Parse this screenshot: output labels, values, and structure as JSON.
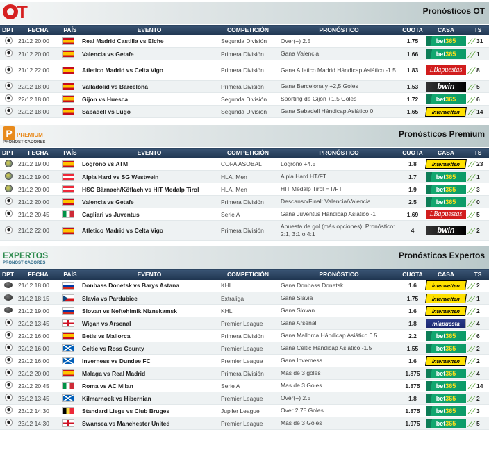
{
  "columns": [
    "DPT",
    "FECHA",
    "PAÍS",
    "EVENTO",
    "COMPETICIÓN",
    "PRONÓSTICO",
    "CUOTA",
    "CASA",
    "TS"
  ],
  "sections": [
    {
      "title": "Pronósticos OT",
      "logo": {
        "name": "ot-logo",
        "text_o": "O",
        "text_t": "T"
      },
      "rows": [
        {
          "sport": "football",
          "fecha": "21/12 20:00",
          "pais": "spain",
          "evento": "Real Madrid Castilla vs Elche",
          "competicion": "Segunda División",
          "pronostico": "Over(+) 2.5",
          "cuota": "1.75",
          "casa": "bet365",
          "ts": "31"
        },
        {
          "sport": "football",
          "fecha": "21/12 20:00",
          "pais": "spain",
          "evento": "Valencia vs Getafe",
          "competicion": "Primera División",
          "pronostico": "Gana Valencia",
          "cuota": "1.66",
          "casa": "bet365",
          "ts": "1"
        },
        {
          "sport": "football",
          "fecha": "21/12 22:00",
          "pais": "spain",
          "evento": "Atletico Madrid vs Celta Vigo",
          "competicion": "Primera División",
          "pronostico": "Gana Atletico Madrid Hándicap Asiático -1.5",
          "cuota": "1.83",
          "casa": "lbapuestas",
          "ts": "8",
          "tall": true
        },
        {
          "sport": "football",
          "fecha": "22/12 18:00",
          "pais": "spain",
          "evento": "Valladolid vs Barcelona",
          "competicion": "Primera División",
          "pronostico": "Gana Barcelona y +2,5 Goles",
          "cuota": "1.53",
          "casa": "bwin",
          "ts": "5"
        },
        {
          "sport": "football",
          "fecha": "22/12 18:00",
          "pais": "spain",
          "evento": "Gijon vs Huesca",
          "competicion": "Segunda División",
          "pronostico": "Sporting de Gijón +1,5 Goles",
          "cuota": "1.72",
          "casa": "bet365",
          "ts": "6"
        },
        {
          "sport": "football",
          "fecha": "22/12 18:00",
          "pais": "spain",
          "evento": "Sabadell vs Lugo",
          "competicion": "Segunda División",
          "pronostico": "Gana Sabadell Hándicap Asiático 0",
          "cuota": "1.65",
          "casa": "interwetten",
          "ts": "14"
        }
      ]
    },
    {
      "title": "Pronósticos Premium",
      "logo": {
        "name": "premium-logo",
        "letter": "P",
        "word": "PREMIUM",
        "sub": "PRONOSTICADORES"
      },
      "rows": [
        {
          "sport": "handball",
          "fecha": "21/12 19:00",
          "pais": "spain",
          "evento": "Logroño vs ATM",
          "competicion": "COPA ASOBAL",
          "pronostico": "Logroño +4.5",
          "cuota": "1.8",
          "casa": "interwetten",
          "ts": "23"
        },
        {
          "sport": "handball",
          "fecha": "21/12 19:00",
          "pais": "austria",
          "evento": "Alpla Hard vs SG Westwein",
          "competicion": "HLA, Men",
          "pronostico": "Alpla Hard HT/FT",
          "cuota": "1.7",
          "casa": "bet365",
          "ts": "1"
        },
        {
          "sport": "handball",
          "fecha": "21/12 20:00",
          "pais": "austria",
          "evento": "HSG Bärnach/Köflach vs HIT Medalp Tirol",
          "competicion": "HLA, Men",
          "pronostico": "HIT Medalp Tirol HT/FT",
          "cuota": "1.9",
          "casa": "bet365",
          "ts": "3"
        },
        {
          "sport": "football",
          "fecha": "21/12 20:00",
          "pais": "spain",
          "evento": "Valencia vs Getafe",
          "competicion": "Primera División",
          "pronostico": "Descanso/Final: Valencia/Valencia",
          "cuota": "2.5",
          "casa": "bet365",
          "ts": "0"
        },
        {
          "sport": "football",
          "fecha": "21/12 20:45",
          "pais": "italy",
          "evento": "Cagliari vs Juventus",
          "competicion": "Serie A",
          "pronostico": "Gana Juventus Hándicap Asiático -1",
          "cuota": "1.69",
          "casa": "lbapuestas",
          "ts": "5"
        },
        {
          "sport": "football",
          "fecha": "21/12 22:00",
          "pais": "spain",
          "evento": "Atletico Madrid vs Celta Vigo",
          "competicion": "Primera División",
          "pronostico": "Apuesta de gol (más opciones): Pronóstico: 2:1, 3:1 o 4:1",
          "cuota": "4",
          "casa": "bwin",
          "ts": "2",
          "tall": true
        }
      ]
    },
    {
      "title": "Pronósticos Expertos",
      "logo": {
        "name": "expertos-logo",
        "word": "EXPERTOS",
        "sub": "PRONOSTICADORES"
      },
      "rows": [
        {
          "sport": "hockey",
          "fecha": "21/12 18:00",
          "pais": "russia",
          "evento": "Donbass Donetsk vs Barys Astana",
          "competicion": "KHL",
          "pronostico": "Gana Donbass Donetsk",
          "cuota": "1.6",
          "casa": "interwetten",
          "ts": "2"
        },
        {
          "sport": "hockey",
          "fecha": "21/12 18:15",
          "pais": "czech",
          "evento": "Slavia vs Pardubice",
          "competicion": "Extraliga",
          "pronostico": "Gana Slavia",
          "cuota": "1.75",
          "casa": "interwetten",
          "ts": "1"
        },
        {
          "sport": "hockey",
          "fecha": "21/12 19:00",
          "pais": "russia",
          "evento": "Slovan vs Neftehimik Niznekamsk",
          "competicion": "KHL",
          "pronostico": "Gana Slovan",
          "cuota": "1.6",
          "casa": "interwetten",
          "ts": "2"
        },
        {
          "sport": "football",
          "fecha": "22/12 13:45",
          "pais": "england",
          "evento": "Wigan vs Arsenal",
          "competicion": "Premier League",
          "pronostico": "Gana Arsenal",
          "cuota": "1.8",
          "casa": "miapuesta",
          "ts": "4"
        },
        {
          "sport": "football",
          "fecha": "22/12 16:00",
          "pais": "spain",
          "evento": "Betis vs Mallorca",
          "competicion": "Primera División",
          "pronostico": "Gana Mallorca Hándicap Asiático 0.5",
          "cuota": "2.2",
          "casa": "bet365",
          "ts": "6"
        },
        {
          "sport": "football",
          "fecha": "22/12 16:00",
          "pais": "scotland",
          "evento": "Celtic vs Ross County",
          "competicion": "Premier League",
          "pronostico": "Gana Celtic Hándicap Asiático -1.5",
          "cuota": "1.55",
          "casa": "bet365",
          "ts": "2"
        },
        {
          "sport": "football",
          "fecha": "22/12 16:00",
          "pais": "scotland",
          "evento": "Inverness vs Dundee FC",
          "competicion": "Premier League",
          "pronostico": "Gana Inverness",
          "cuota": "1.6",
          "casa": "interwetten",
          "ts": "2"
        },
        {
          "sport": "football",
          "fecha": "22/12 20:00",
          "pais": "spain",
          "evento": "Malaga vs Real Madrid",
          "competicion": "Primera División",
          "pronostico": "Mas de 3 goles",
          "cuota": "1.875",
          "casa": "bet365",
          "ts": "4"
        },
        {
          "sport": "football",
          "fecha": "22/12 20:45",
          "pais": "italy",
          "evento": "Roma vs AC Milan",
          "competicion": "Serie A",
          "pronostico": "Mas de 3 Goles",
          "cuota": "1.875",
          "casa": "bet365",
          "ts": "14"
        },
        {
          "sport": "football",
          "fecha": "23/12 13:45",
          "pais": "scotland",
          "evento": "Kilmarnock vs Hibernian",
          "competicion": "Premier League",
          "pronostico": "Over(+) 2.5",
          "cuota": "1.8",
          "casa": "bet365",
          "ts": "2"
        },
        {
          "sport": "football",
          "fecha": "23/12 14:30",
          "pais": "belgium",
          "evento": "Standard Liege vs Club Bruges",
          "competicion": "Jupiler League",
          "pronostico": "Over 2,75 Goles",
          "cuota": "1.875",
          "casa": "bet365",
          "ts": "3"
        },
        {
          "sport": "football",
          "fecha": "23/12 14:30",
          "pais": "england",
          "evento": "Swansea vs Manchester United",
          "competicion": "Premier League",
          "pronostico": "Mas de 3 Goles",
          "cuota": "1.975",
          "casa": "bet365",
          "ts": "5"
        }
      ]
    }
  ],
  "bookmakers": {
    "bet365": {
      "a": "bet",
      "b": "365"
    },
    "lbapuestas": {
      "a": "LBapuestas"
    },
    "bwin": {
      "a": "bwin"
    },
    "interwetten": {
      "a": "interwetten"
    },
    "miapuesta": {
      "a": "miapuesta"
    }
  },
  "flags": {
    "spain": "flag-es",
    "austria": "flag-at",
    "italy": "flag-it",
    "russia": "flag-ru",
    "czech": "flag-cz",
    "england": "flag-en",
    "scotland": "flag-sc",
    "belgium": "flag-be"
  },
  "icons": {
    "ts": "thumbs-tipster-icon"
  }
}
